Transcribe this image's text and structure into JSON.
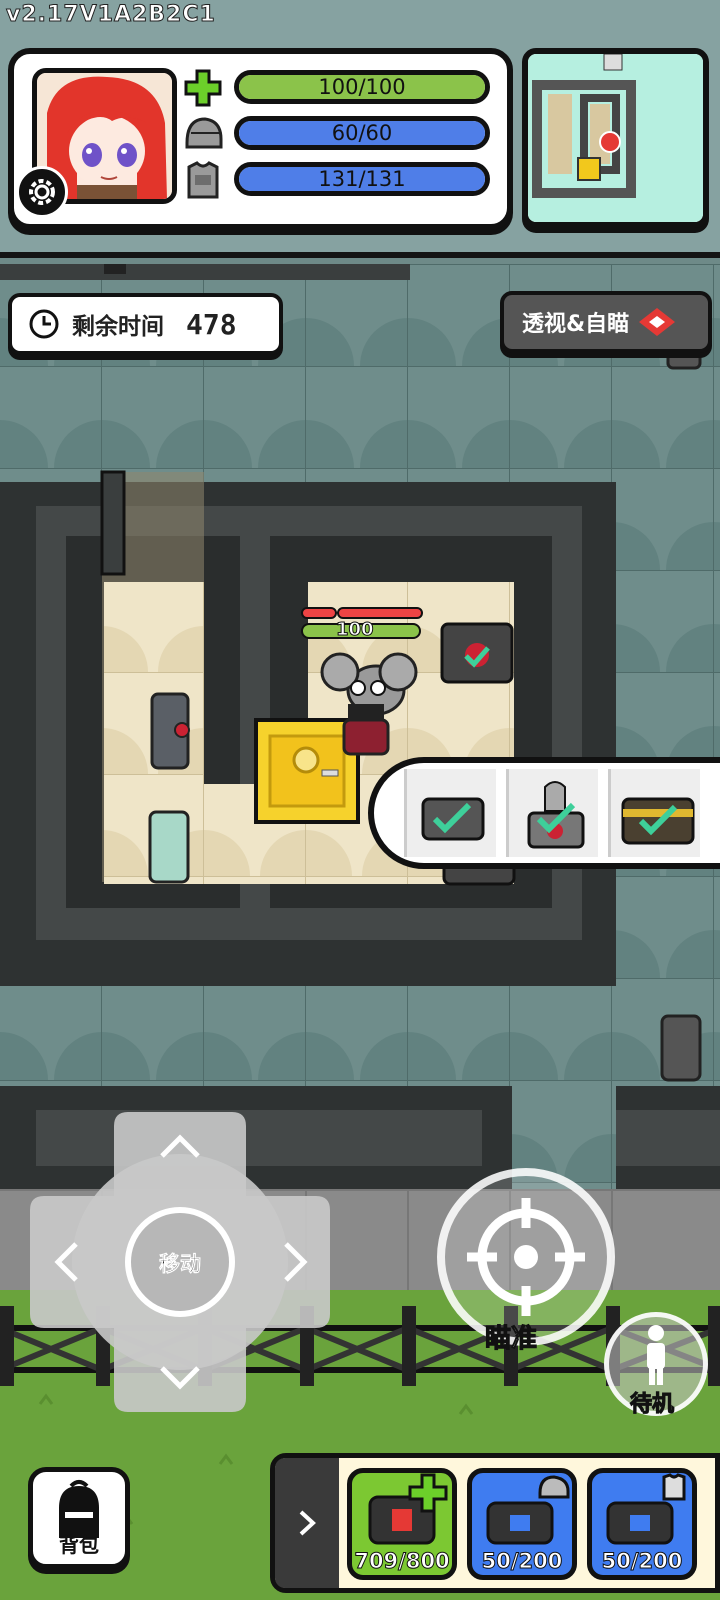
{
  "version": "v2.17V1A2B2C1",
  "stats": {
    "health": {
      "text": "100/100",
      "fill": 1.0,
      "color": "#8bc34a"
    },
    "helmet": {
      "text": "60/60",
      "fill": 1.0,
      "color": "#4f7ee8"
    },
    "armor": {
      "text": "131/131",
      "fill": 1.0,
      "color": "#4f7ee8"
    }
  },
  "timer": {
    "label": "剩余时间",
    "value": "478"
  },
  "xray_button": {
    "label": "透视&自瞄"
  },
  "player": {
    "hp_text": "100"
  },
  "controls": {
    "dpad_label": "移动",
    "aim_label": "瞄准",
    "idle_label": "待机"
  },
  "bag": {
    "label": "背包"
  },
  "quick_items": [
    {
      "icon": "medkit-bag-icon",
      "value": "709/800",
      "color": "#7cc832"
    },
    {
      "icon": "helmet-bag-icon",
      "value": "50/200",
      "color": "#3f7cf0"
    },
    {
      "icon": "armor-bag-icon",
      "value": "50/200",
      "color": "#3f7cf0"
    }
  ],
  "colors": {
    "accent_red": "#e53935",
    "floor_teal": "#6f8d8b",
    "wall": "#2f3333"
  }
}
